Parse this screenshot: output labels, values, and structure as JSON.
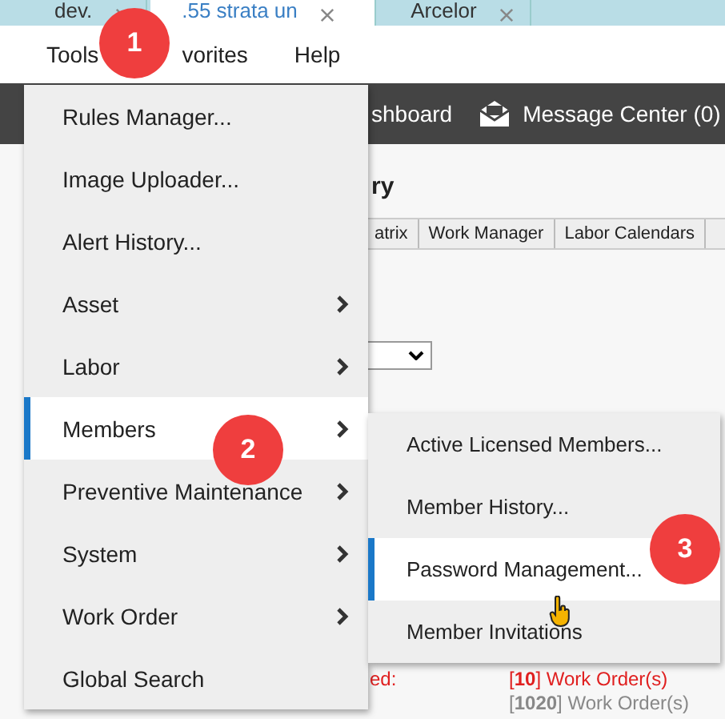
{
  "browser_tabs": [
    {
      "label": "dev.",
      "selected": false
    },
    {
      "label": ".55 strata un",
      "selected": true
    },
    {
      "label": "Arcelor",
      "selected": false
    }
  ],
  "menu_bar": [
    {
      "label": "Tools"
    },
    {
      "label": "vorites"
    },
    {
      "label": "Help"
    }
  ],
  "top_bar": {
    "items": [
      {
        "label": "shboard"
      },
      {
        "label": "Message Center (0)"
      }
    ]
  },
  "page": {
    "heading": "ry",
    "tabs": [
      {
        "label": "atrix"
      },
      {
        "label": "Work Manager"
      },
      {
        "label": "Labor Calendars"
      }
    ],
    "summary": [
      {
        "label": "ed:",
        "value": "[**10**] Work Order(s)",
        "alert": true
      },
      {
        "value": "[**1020**] Work Order(s)",
        "alert": false
      }
    ]
  },
  "tools_menu": [
    {
      "label": "Rules Manager...",
      "kind": "action",
      "selected": false
    },
    {
      "label": "Image Uploader...",
      "kind": "action",
      "selected": false
    },
    {
      "label": "Alert History...",
      "kind": "action",
      "selected": false
    },
    {
      "label": "Asset",
      "kind": "submenu",
      "selected": false
    },
    {
      "label": "Labor",
      "kind": "submenu",
      "selected": false
    },
    {
      "label": "Members",
      "kind": "submenu",
      "selected": true
    },
    {
      "label": "Preventive Maintenance",
      "kind": "submenu",
      "selected": false
    },
    {
      "label": "System",
      "kind": "submenu",
      "selected": false
    },
    {
      "label": "Work Order",
      "kind": "submenu",
      "selected": false
    },
    {
      "label": "Global Search",
      "kind": "action",
      "selected": false
    }
  ],
  "members_submenu": [
    {
      "label": "Active Licensed Members...",
      "selected": false
    },
    {
      "label": "Member History...",
      "selected": false
    },
    {
      "label": "Password Management...",
      "selected": true
    },
    {
      "label": "Member Invitations",
      "selected": false
    }
  ],
  "step_badges": [
    "1",
    "2",
    "3"
  ]
}
